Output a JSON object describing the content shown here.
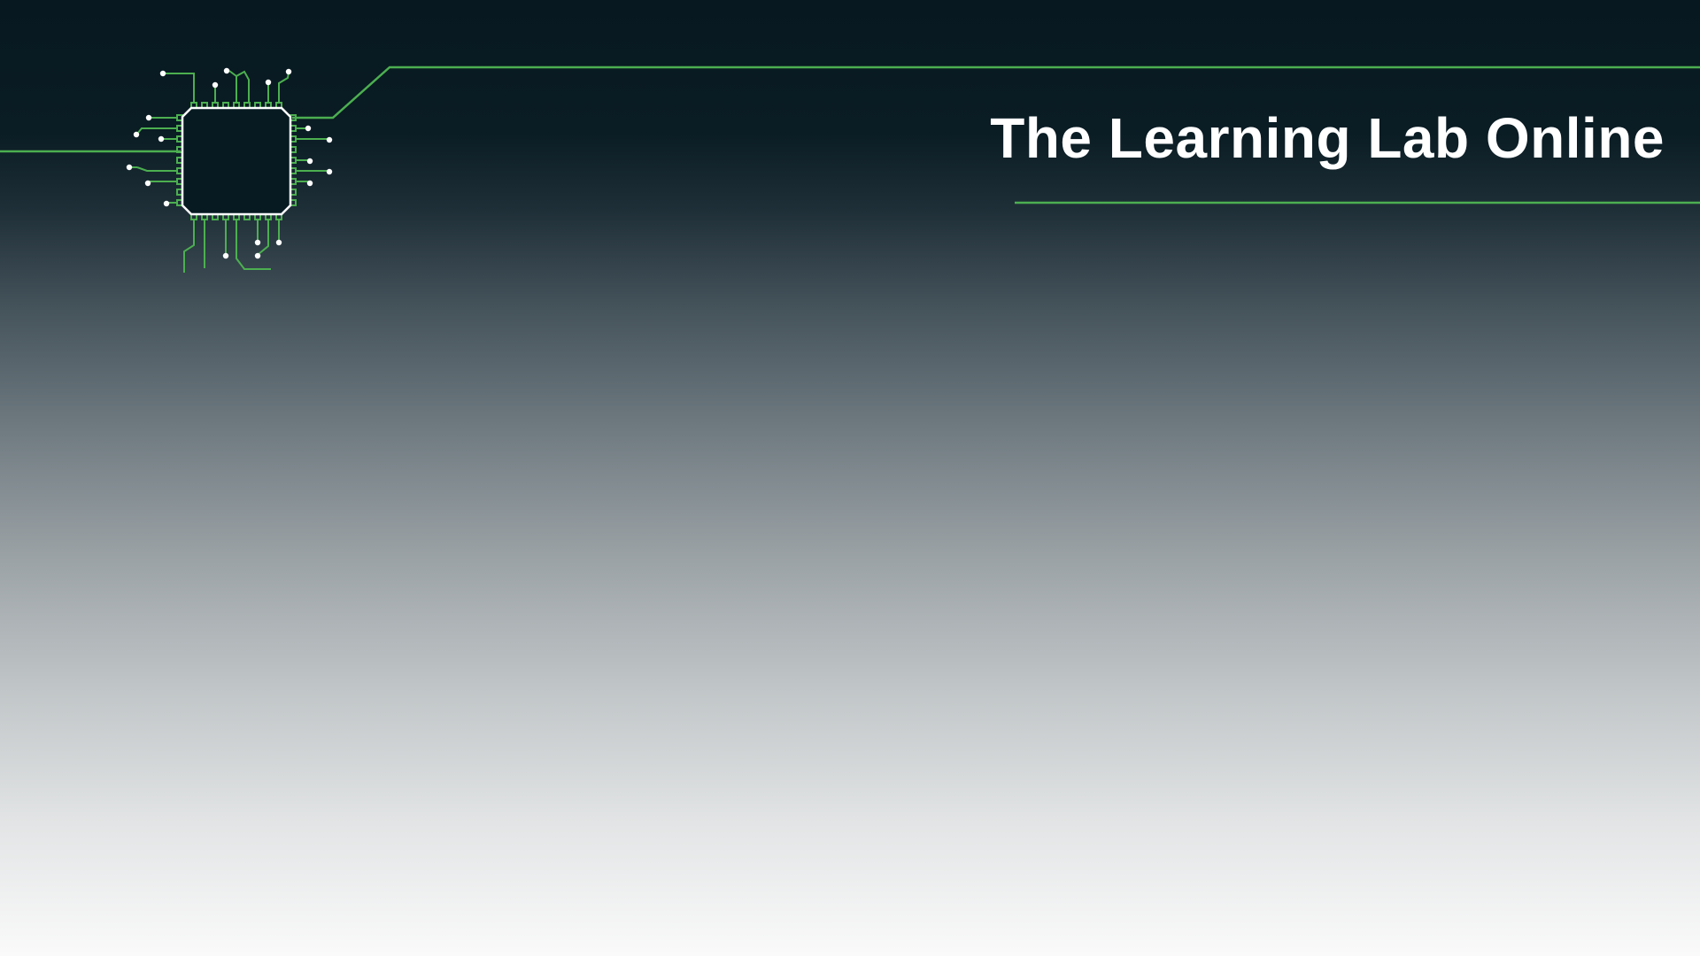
{
  "header": {
    "title": "The Learning Lab Online"
  },
  "logo": {
    "icon": "circuit-chip-icon"
  },
  "colors": {
    "accent": "#4caf50",
    "title_text": "#ffffff",
    "background_top": "#071820",
    "background_bottom": "#fafafa"
  }
}
